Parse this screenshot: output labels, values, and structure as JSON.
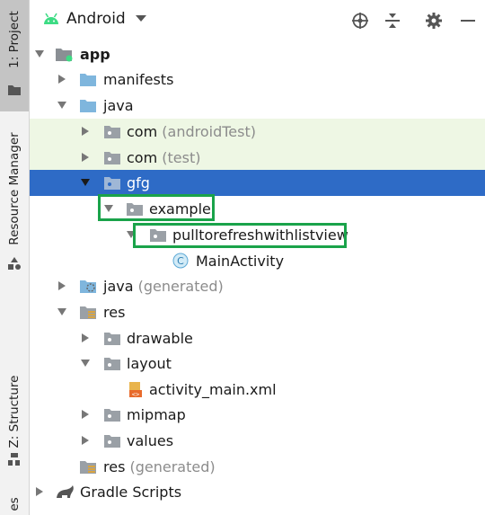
{
  "toolbar": {
    "title": "Android",
    "icons": [
      "android-icon",
      "dropdown-caret-icon",
      "locate-icon",
      "collapse-all-icon",
      "settings-icon",
      "minimize-icon"
    ]
  },
  "side_strip": {
    "tabs": [
      {
        "label": "1: Project",
        "icon": "folder-icon",
        "active": true
      },
      {
        "label": "Resource Manager",
        "icon": "resources-icon",
        "active": false
      },
      {
        "label": "Z: Structure",
        "icon": "structure-icon",
        "active": false
      },
      {
        "label": "es",
        "icon": "",
        "active": false
      }
    ]
  },
  "tree": {
    "rows": [
      {
        "name": "app",
        "suffix": "",
        "icon": "app-module-icon",
        "expanded": true
      },
      {
        "name": "manifests",
        "suffix": "",
        "icon": "folder-icon",
        "expanded": false
      },
      {
        "name": "java",
        "suffix": "",
        "icon": "folder-icon",
        "expanded": true
      },
      {
        "name": "com",
        "suffix": "(androidTest)",
        "icon": "package-icon",
        "expanded": false
      },
      {
        "name": "com",
        "suffix": "(test)",
        "icon": "package-icon",
        "expanded": false
      },
      {
        "name": "gfg",
        "suffix": "",
        "icon": "package-icon",
        "expanded": true,
        "selected": true
      },
      {
        "name": "example",
        "suffix": "",
        "icon": "package-icon",
        "expanded": true
      },
      {
        "name": "pulltorefreshwithlistview",
        "suffix": "",
        "icon": "package-icon",
        "expanded": true
      },
      {
        "name": "MainActivity",
        "suffix": "",
        "icon": "class-icon",
        "class_letter": "C"
      },
      {
        "name": "java",
        "suffix": "(generated)",
        "icon": "generated-folder-icon",
        "expanded": false
      },
      {
        "name": "res",
        "suffix": "",
        "icon": "resources-folder-icon",
        "expanded": true
      },
      {
        "name": "drawable",
        "suffix": "",
        "icon": "package-icon",
        "expanded": false
      },
      {
        "name": "layout",
        "suffix": "",
        "icon": "package-icon",
        "expanded": true
      },
      {
        "name": "activity_main.xml",
        "suffix": "",
        "icon": "layout-xml-icon"
      },
      {
        "name": "mipmap",
        "suffix": "",
        "icon": "package-icon",
        "expanded": false
      },
      {
        "name": "values",
        "suffix": "",
        "icon": "package-icon",
        "expanded": false
      },
      {
        "name": "res",
        "suffix": "(generated)",
        "icon": "resources-folder-icon"
      },
      {
        "name": "Gradle Scripts",
        "suffix": "",
        "icon": "gradle-icon",
        "expanded": false
      }
    ]
  },
  "colors": {
    "selection": "#2e6bc6",
    "test_highlight": "#eef7e4",
    "annotation_box": "#1aa34a",
    "folder_blue": "#7fb6dd",
    "package_gray": "#9aa0a6"
  }
}
